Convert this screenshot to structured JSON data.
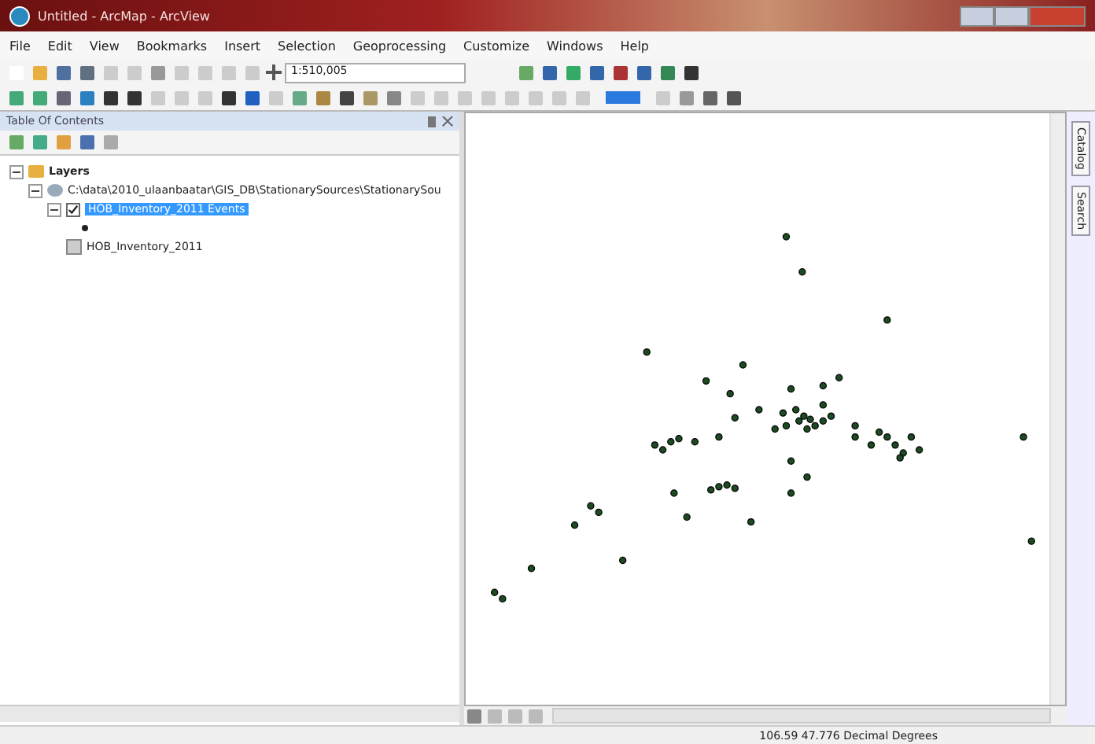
{
  "window": {
    "title": "Untitled - ArcMap - ArcView"
  },
  "menu": [
    "File",
    "Edit",
    "View",
    "Bookmarks",
    "Insert",
    "Selection",
    "Geoprocessing",
    "Customize",
    "Windows",
    "Help"
  ],
  "toolbar": {
    "scale": "1:510,005"
  },
  "toc": {
    "title": "Table Of Contents",
    "tree": [
      {
        "label": "Layers",
        "expanded": true,
        "kind": "frame",
        "children": [
          {
            "label": "C:\\data\\2010_ulaanbaatar\\GIS_DB\\StationarySources\\StationarySou",
            "expanded": true,
            "kind": "folder",
            "children": [
              {
                "label": "HOB_Inventory_2011 Events",
                "kind": "layer",
                "checked": true,
                "selected": true,
                "expanded": true
              },
              {
                "label": "HOB_Inventory_2011",
                "kind": "table",
                "selected": false
              }
            ]
          }
        ]
      }
    ]
  },
  "side_tabs": [
    "Catalog",
    "Search"
  ],
  "status_bar": {
    "coordinates": "106.59  47.776 Decimal Degrees"
  }
}
